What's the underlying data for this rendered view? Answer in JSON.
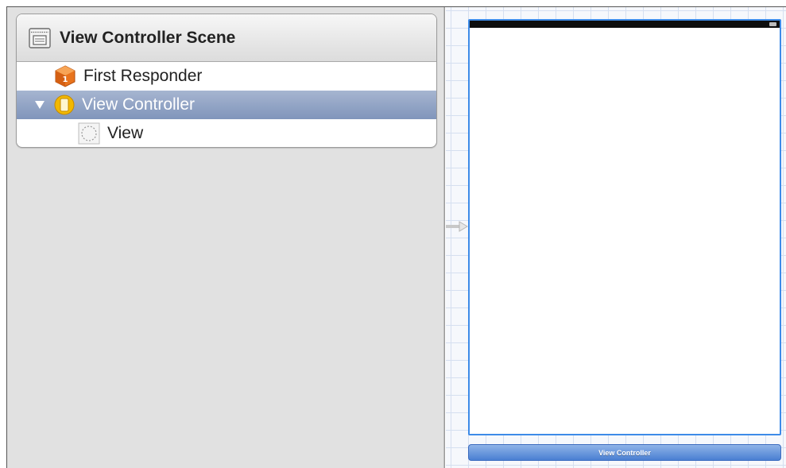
{
  "scene": {
    "title": "View Controller Scene",
    "items": [
      {
        "label": "First Responder",
        "icon": "first-responder-icon",
        "selected": false
      },
      {
        "label": "View Controller",
        "icon": "view-controller-icon",
        "selected": true
      },
      {
        "label": "View",
        "icon": "view-icon",
        "selected": false
      }
    ]
  },
  "canvas": {
    "dock_label": "View Controller"
  },
  "colors": {
    "selection": "#8a9cc0",
    "frame_accent": "#3d8be8",
    "dock": "#5b8bd9",
    "first_responder": "#e8731c",
    "view_controller": "#f2b800"
  }
}
